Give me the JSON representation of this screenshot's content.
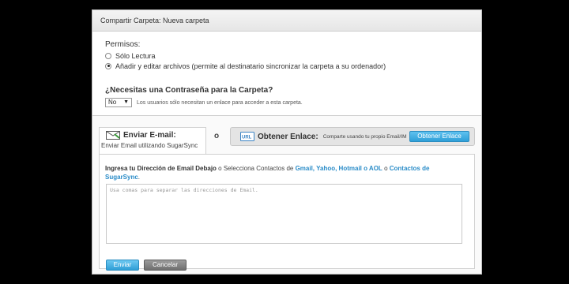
{
  "dialog": {
    "title": "Compartir Carpeta: Nueva carpeta"
  },
  "permissions": {
    "title": "Permisos:",
    "options": [
      {
        "label": "Sólo Lectura",
        "checked": false
      },
      {
        "label": "Añadir y editar archivos (permite al destinatario sincronizar la carpeta a su ordenador)",
        "checked": true
      }
    ]
  },
  "password": {
    "title": "¿Necesitas una Contraseña para la Carpeta?",
    "selected": "No",
    "note": "Los usuarios sólo necesitan un enlace para acceder a esta carpeta."
  },
  "email_tab": {
    "label": "Enviar E-mail:",
    "sublabel": "Enviar Email utilizando SugarSync",
    "icon": "envelope-icon"
  },
  "or_text": "o",
  "link_tab": {
    "label": "Obtener Enlace:",
    "description": "Comparte usando tu propio Email/IM",
    "button": "Obtener Enlace",
    "icon": "url-icon"
  },
  "email_panel": {
    "instruction_bold": "Ingresa tu Dirección de Email Debajo",
    "instruction_mid": "o Selecciona Contactos de",
    "link1": "Gmail, Yahoo, Hotmail o AOL",
    "instruction_or": "o",
    "link2": "Contactos de SugarSync",
    "link2_end": ".",
    "placeholder": "Usa comas para separar las direcciones de Email.",
    "send_button": "Enviar",
    "cancel_button": "Cancelar"
  },
  "colors": {
    "accent_blue": "#2e9fd8",
    "link_blue": "#2a8cc8",
    "cancel_gray": "#7a7a7a"
  }
}
